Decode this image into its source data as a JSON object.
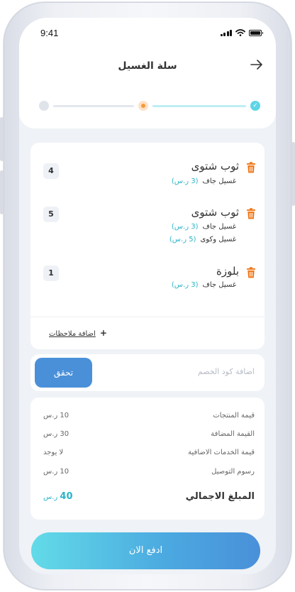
{
  "status_bar": {
    "time": "9:41"
  },
  "header": {
    "title": "سلة الغسيل",
    "back_icon": "arrow-right-icon"
  },
  "stepper": {
    "steps_total": 3,
    "current_step": 2
  },
  "items": [
    {
      "name": "ثوب شتوى",
      "qty": "4",
      "services": [
        {
          "name": "غسيل جاف",
          "price": "(3 ر.س)"
        }
      ]
    },
    {
      "name": "ثوب شتوى",
      "qty": "5",
      "services": [
        {
          "name": "غسيل جاف",
          "price": "(3 ر.س)"
        },
        {
          "name": "غسيل وكوى",
          "price": "(5 ر.س)"
        }
      ]
    },
    {
      "name": "بلوزة",
      "qty": "1",
      "services": [
        {
          "name": "غسيل جاف",
          "price": "(3 ر.س)"
        }
      ]
    }
  ],
  "notes": {
    "label": "اضافة ملاحظات",
    "icon": "+"
  },
  "discount": {
    "placeholder": "اضافة كود الخصم",
    "button": "تحقق"
  },
  "summary": {
    "rows": [
      {
        "label": "قيمة المنتجات",
        "value": "10 ر.س"
      },
      {
        "label": "القيمة المضافة",
        "value": "30 ر.س"
      },
      {
        "label": "قيمة الخدمات الاضافية",
        "value": "لا يوجد"
      },
      {
        "label": "رسوم التوصيل",
        "value": "10 ر.س"
      }
    ],
    "total_label": "المبلغ الاجمالي",
    "total_amount": "40",
    "total_currency": "ر.س"
  },
  "pay_button": "ادفع الان",
  "colors": {
    "accent": "#4a90d9",
    "teal": "#2bb5c8",
    "orange": "#f59a3b",
    "check": "#5dd5e6"
  }
}
